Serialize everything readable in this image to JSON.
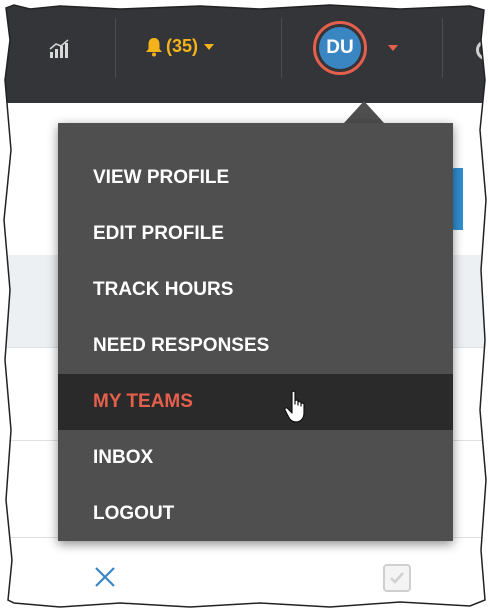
{
  "header": {
    "stats_icon": "bar-chart-icon",
    "notifications": {
      "icon": "bell-icon",
      "count_label": "(35)"
    },
    "user": {
      "avatar_initials": "DU"
    },
    "colors": {
      "bar": "#333538",
      "bell": "#f4b31a",
      "avatar_ring": "#e5604c",
      "avatar_fill": "#3a86c3"
    }
  },
  "user_menu": {
    "items": [
      {
        "label": "VIEW PROFILE"
      },
      {
        "label": "EDIT PROFILE"
      },
      {
        "label": "TRACK HOURS"
      },
      {
        "label": "NEED RESPONSES"
      },
      {
        "label": "MY TEAMS",
        "active": true
      },
      {
        "label": "INBOX"
      },
      {
        "label": "LOGOUT"
      }
    ],
    "colors": {
      "background": "#4f4f4f",
      "active_background": "#2a2a2a",
      "active_text": "#e5604c"
    }
  },
  "page": {
    "close_icon": "x-icon",
    "checkbox_icon": "checkmark-icon"
  }
}
